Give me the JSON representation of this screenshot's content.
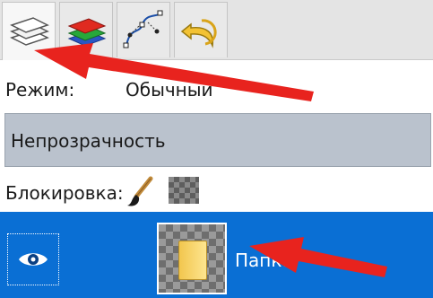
{
  "tabs": [
    {
      "icon": "layers-icon",
      "active": true
    },
    {
      "icon": "channels-icon",
      "active": false
    },
    {
      "icon": "paths-icon",
      "active": false
    },
    {
      "icon": "undo-history-icon",
      "active": false
    }
  ],
  "mode": {
    "label": "Режим:",
    "value": "Обычный"
  },
  "opacity": {
    "label": "Непрозрачность"
  },
  "lock": {
    "label": "Блокировка:",
    "icons": [
      "lock-pixels-brush-icon",
      "lock-alpha-icon"
    ]
  },
  "layer": {
    "name": "Папка",
    "visible": true,
    "selected": true
  },
  "colors": {
    "selection": "#0a6fd4",
    "opacity_bar": "#bac2cd",
    "annotation_arrow": "#e8231e"
  }
}
